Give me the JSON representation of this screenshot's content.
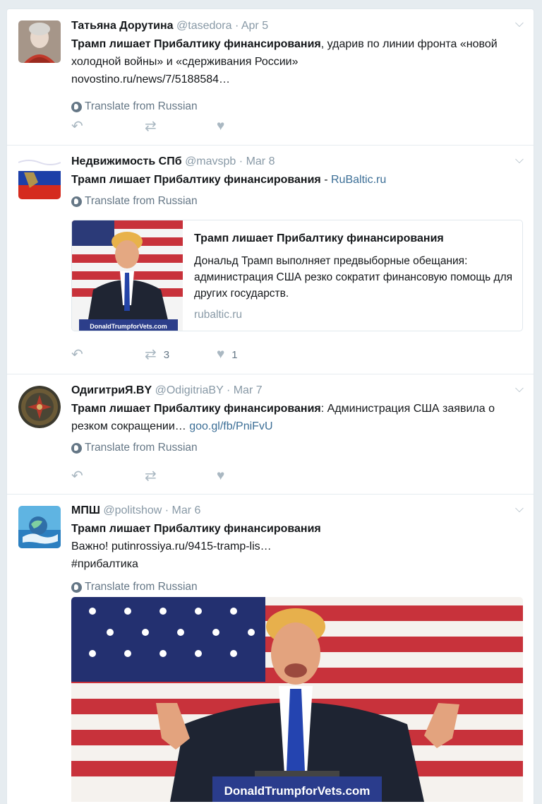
{
  "tweets": [
    {
      "name": "Татьяна Дорутина",
      "handle": "@tasedora",
      "dot": "·",
      "date": "Apr 5",
      "text_bold": "Трамп лишает Прибалтику финансирования",
      "text_rest": ", ударив по линии фронта «новой холодной войны» и «сдерживания России»",
      "link": "novostino.ru/news/7/5188584…",
      "translate": "Translate from Russian"
    },
    {
      "name": "Недвижимость СПб",
      "handle": "@mavspb",
      "dot": "·",
      "date": "Mar 8",
      "text_bold": "Трамп лишает Прибалтику финансирования",
      "text_sep": " - ",
      "link": "RuBaltic.ru",
      "translate": "Translate from Russian",
      "card": {
        "title": "Трамп лишает Прибалтику финансирования",
        "description": "Дональд Трамп выполняет предвыборные обещания: администрация США резко сократит финансовую помощь для других государств.",
        "domain": "rubaltic.ru",
        "banner": "DonaldTrumpforVets.com"
      },
      "retweets": "3",
      "likes": "1"
    },
    {
      "name": "ОдигитриЯ.BY",
      "handle": "@OdigitriaBY",
      "dot": "·",
      "date": "Mar 7",
      "text_bold": "Трамп лишает Прибалтику финансирования",
      "text_rest": ": Администрация США заявила о резком сокращении… ",
      "link": "goo.gl/fb/PniFvU",
      "translate": "Translate from Russian"
    },
    {
      "name": "МПШ",
      "handle": "@politshow",
      "dot": "·",
      "date": "Mar 6",
      "text_bold": "Трамп лишает Прибалтику финансирования",
      "text_line2": "Важно! ",
      "link": "putinrossiya.ru/9415-tramp-lis…",
      "hashtag": "#прибалтика",
      "translate": "Translate from Russian",
      "media_banner": "DonaldTrumpforVets.com"
    }
  ],
  "icons": {
    "reply": "reply-icon",
    "retweet": "retweet-icon",
    "like": "heart-icon",
    "more": "chevron-down-icon",
    "globe": "globe-icon"
  },
  "colors": {
    "link": "#3b6e96",
    "muted": "#8899a6",
    "icon": "#aab8c2"
  }
}
